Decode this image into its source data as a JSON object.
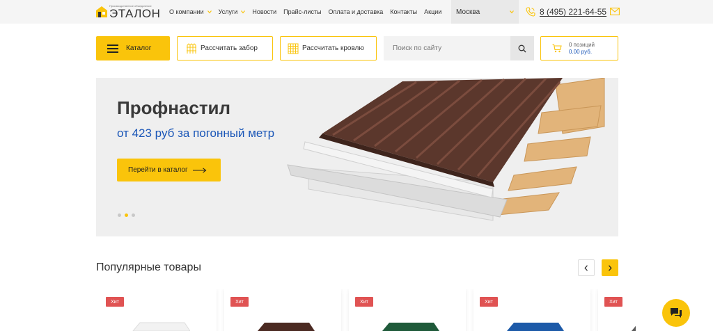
{
  "header": {
    "logo_small": "Производственное объединение",
    "logo_big": "ЭТАЛОН",
    "nav": [
      {
        "label": "О компании",
        "dropdown": true
      },
      {
        "label": "Услуги",
        "dropdown": true
      },
      {
        "label": "Новости",
        "dropdown": false
      },
      {
        "label": "Прайс-листы",
        "dropdown": false
      },
      {
        "label": "Оплата и доставка",
        "dropdown": false
      },
      {
        "label": "Контакты",
        "dropdown": false
      },
      {
        "label": "Акции",
        "dropdown": false
      }
    ],
    "city": "Москва",
    "phone": "8 (495) 221-64-55",
    "icons": {
      "phone": "phone-icon",
      "mail": "mail-icon"
    }
  },
  "toolbar": {
    "catalog_label": "Каталог",
    "fence_label": "Рассчитать забор",
    "roof_label": "Рассчитать кровлю",
    "search_placeholder": "Поиск по сайту",
    "cart_count": "0 позиций",
    "cart_sum": "0.00 руб."
  },
  "banner": {
    "title": "Профнастил",
    "subtitle": "от 423 руб за погонный метр",
    "button_label": "Перейти в каталог",
    "slides": 3,
    "active_slide": 2
  },
  "popular": {
    "title": "Популярные товары",
    "products": [
      {
        "badge": "Хит",
        "color": "#f2f2f2"
      },
      {
        "badge": "Хит",
        "color": "#4b2a22"
      },
      {
        "badge": "Хит",
        "color": "#1f5a3a"
      },
      {
        "badge": "Хит",
        "color": "#1d5aa8"
      },
      {
        "badge": "Хит",
        "color": "#5a5a5a"
      }
    ]
  },
  "colors": {
    "accent": "#fac40b",
    "link": "#1a56b7",
    "badge": "#e05353"
  }
}
